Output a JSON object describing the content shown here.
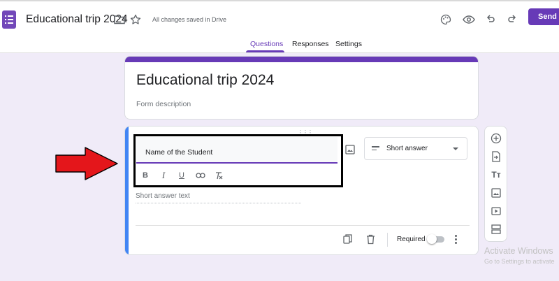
{
  "header": {
    "doc_title": "Educational trip 2024",
    "saved_status": "All changes saved in Drive",
    "send_label": "Send"
  },
  "tabs": [
    {
      "label": "Questions",
      "active": true
    },
    {
      "label": "Responses",
      "active": false
    },
    {
      "label": "Settings",
      "active": false
    }
  ],
  "form": {
    "title": "Educational trip 2024",
    "description_placeholder": "Form description"
  },
  "question": {
    "title": "Name of the Student",
    "type_label": "Short answer",
    "answer_placeholder": "Short answer text",
    "required_label": "Required",
    "required": false
  },
  "watermark": {
    "line1": "Activate Windows",
    "line2": "Go to Settings to activate"
  },
  "colors": {
    "accent": "#673ab7",
    "question_focus_bar": "#4285f4",
    "annotation_arrow": "#e4161b"
  }
}
